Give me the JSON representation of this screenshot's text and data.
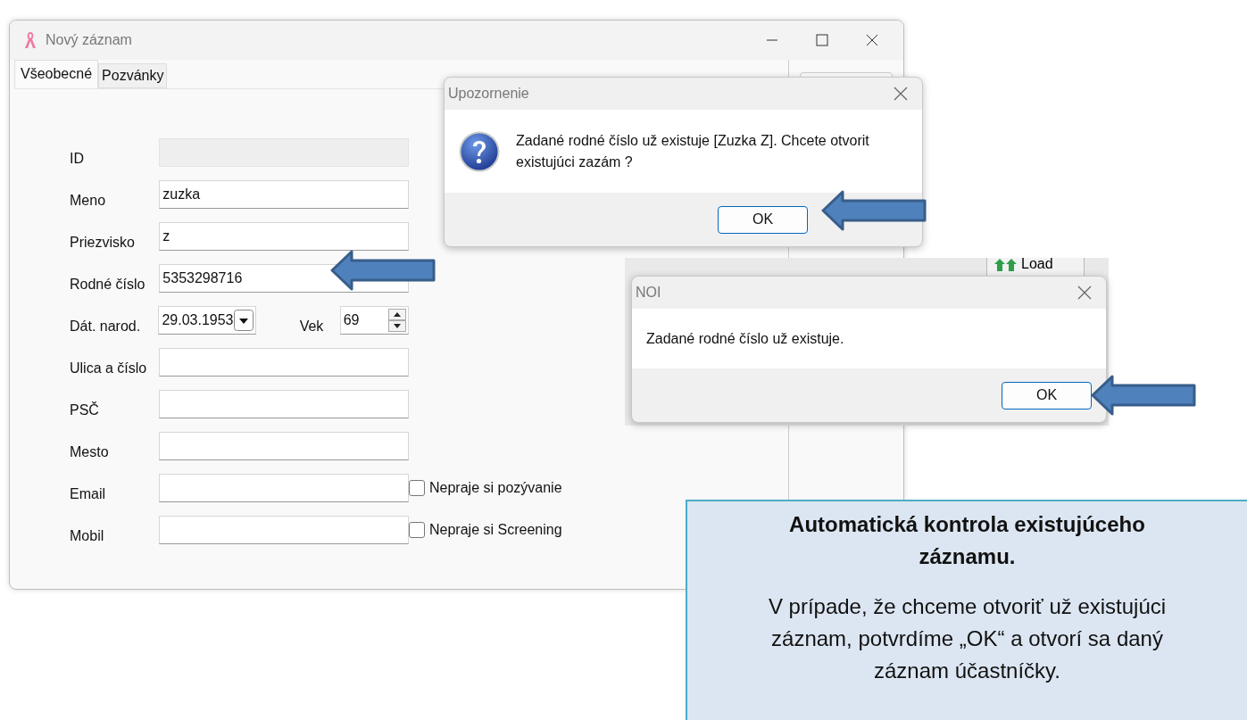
{
  "window": {
    "title": "Nový záznam"
  },
  "tabs": [
    {
      "label": "Všeobecné",
      "selected": true
    },
    {
      "label": "Pozvánky",
      "selected": false
    }
  ],
  "fields": [
    {
      "kind": "readonly",
      "label": "ID"
    },
    {
      "kind": "text",
      "label": "Meno",
      "value": "zuzka"
    },
    {
      "kind": "text",
      "label": "Priezvisko",
      "value": "z"
    },
    {
      "kind": "text",
      "label": "Rodné číslo",
      "value": "5353298716"
    },
    {
      "kind": "date",
      "label": "Dát. narod.",
      "value": "29.03.1953",
      "extra_label": "Vek",
      "extra_value": "69"
    },
    {
      "kind": "text",
      "label": "Ulica a číslo"
    },
    {
      "kind": "text",
      "label": "PSČ"
    },
    {
      "kind": "text",
      "label": "Mesto"
    },
    {
      "kind": "text",
      "label": "Email"
    },
    {
      "kind": "text",
      "label": "Mobil"
    }
  ],
  "checkboxes": [
    {
      "label": "Nepraje si pozývanie",
      "checked": false
    },
    {
      "label": "Nepraje si Screening",
      "checked": false
    }
  ],
  "background_button": {
    "label": "Load"
  },
  "dialogs": [
    {
      "title": "Upozornenie",
      "kind": "question",
      "message": "Zadané rodné číslo už existuje [Zuzka Z]. Chcete otvorit existujúci zazám ?",
      "buttons": [
        {
          "label": "OK",
          "default": true
        }
      ]
    },
    {
      "title": "NOI",
      "kind": "plain",
      "message": "Zadané rodné číslo už existuje.",
      "buttons": [
        {
          "label": "OK",
          "default": true
        }
      ]
    }
  ],
  "callout": {
    "title": "Automatická kontrola existujúceho záznamu.",
    "body": "V prípade, že chceme otvoriť už existujúci záznam, potvrdíme „OK“ a otvorí sa daný záznam účastníčky."
  }
}
